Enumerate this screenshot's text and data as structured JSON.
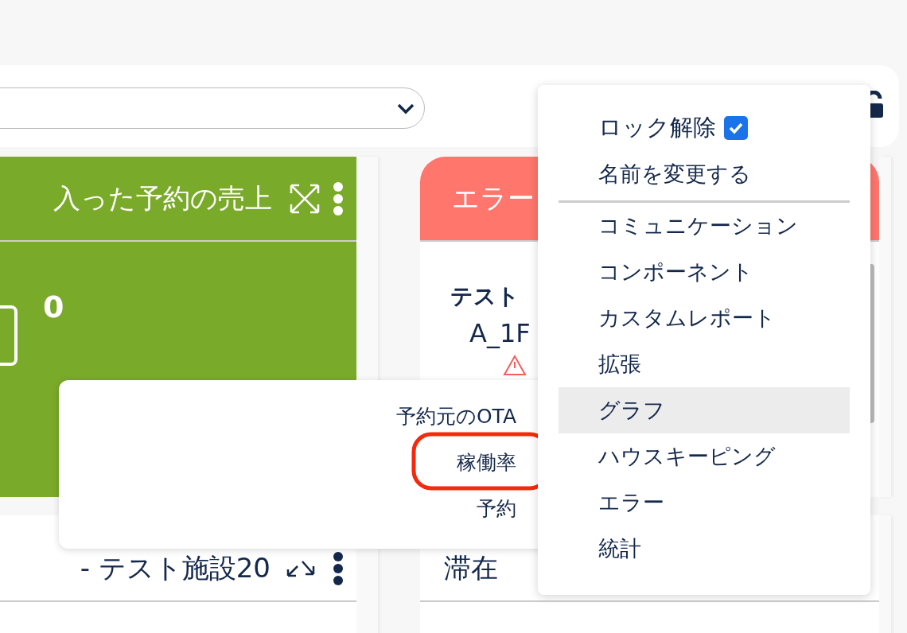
{
  "cards": [
    {
      "kind": "metric",
      "title": "入った予約の売上",
      "color": "#7aaa2a",
      "value": "0"
    },
    {
      "kind": "list",
      "title": "エラー",
      "color": "#ff766d",
      "facility": "テスト",
      "room": "A_1F"
    },
    {
      "kind": "plain",
      "title": "- テスト施設20"
    },
    {
      "kind": "titled",
      "title": "滞在"
    }
  ],
  "widget_menu": {
    "lock": {
      "label": "ロック解除",
      "checked": true
    },
    "rename": "名前を変更する",
    "categories": [
      {
        "label": "コミュニケーション",
        "selected": false
      },
      {
        "label": "コンポーネント",
        "selected": false
      },
      {
        "label": "カスタムレポート",
        "selected": false
      },
      {
        "label": "拡張",
        "selected": false
      },
      {
        "label": "グラフ",
        "selected": true
      },
      {
        "label": "ハウスキーピング",
        "selected": false
      },
      {
        "label": "エラー",
        "selected": false
      },
      {
        "label": "統計",
        "selected": false
      }
    ]
  },
  "graph_submenu": {
    "items": [
      {
        "label": "予約元のOTA",
        "highlighted": false
      },
      {
        "label": "稼働率",
        "highlighted": true
      },
      {
        "label": "予約",
        "highlighted": false
      }
    ]
  }
}
